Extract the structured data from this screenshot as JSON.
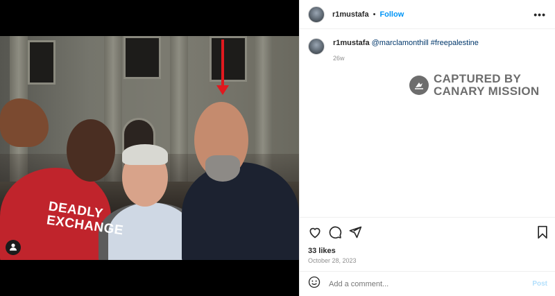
{
  "post": {
    "username": "r1mustafa",
    "follow_label": "Follow",
    "separator": "•",
    "more_label": "•••",
    "caption_mention": "@marclamonthill",
    "caption_hashtag": "#freepalestine",
    "age": "26w",
    "likes": "33 likes",
    "date": "October 28, 2023",
    "comment_placeholder": "Add a comment...",
    "post_label": "Post"
  },
  "watermark": {
    "line1": "CAPTURED BY",
    "line2": "CANARY MISSION"
  },
  "photo": {
    "shirt_line1": "DEADLY",
    "shirt_line2": "EXCHANGE"
  },
  "icons": {
    "user_tag": "person-icon",
    "like": "heart-icon",
    "comment": "comment-icon",
    "share": "send-icon",
    "save": "bookmark-icon",
    "emoji": "emoji-icon",
    "watermark_logo": "canary-bird-icon"
  },
  "colors": {
    "follow": "#0095f6",
    "arrow": "#e0191f",
    "shirt": "#c0242c",
    "watermark": "#6d6d6d"
  }
}
